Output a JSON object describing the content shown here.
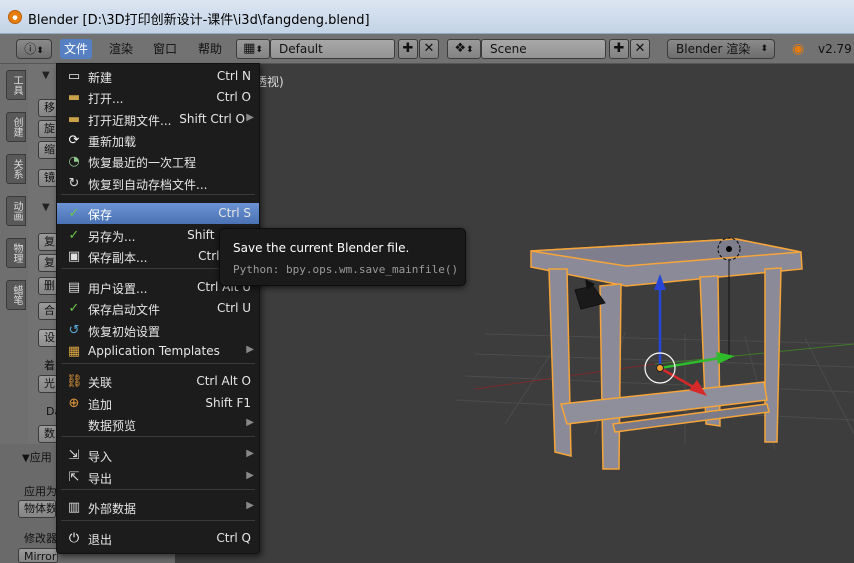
{
  "window": {
    "title": "Blender [D:\\3D打印创新设计-课件\\i3d\\fangdeng.blend]"
  },
  "header": {
    "menus": [
      "文件",
      "渲染",
      "窗口",
      "帮助"
    ],
    "screen_layout": "Default",
    "scene": "Scene",
    "render_engine": "Blender 渲染",
    "version": "v2.79"
  },
  "tool_tabs": [
    "工具",
    "创建",
    "关系",
    "动画",
    "物理",
    "蜡笔"
  ],
  "tool_panel": {
    "partial_labels": [
      "移",
      "旋",
      "缩",
      "镜",
      "复",
      "复",
      "删",
      "合",
      "设",
      "着",
      "光",
      "Da",
      "数",
      "应用",
      "应用为",
      "物体数",
      "修改器",
      "Mirror"
    ]
  },
  "viewport": {
    "label": "透视)",
    "obscured_label": "用"
  },
  "file_menu": {
    "items": [
      {
        "icon": "new-file-icon",
        "label": "新建",
        "shortcut": "Ctrl N"
      },
      {
        "icon": "open-folder-icon",
        "label": "打开...",
        "shortcut": "Ctrl O"
      },
      {
        "icon": "open-recent-icon",
        "label": "打开近期文件...",
        "shortcut": "Shift Ctrl O",
        "submenu": true
      },
      {
        "icon": "reload-icon",
        "label": "重新加载",
        "shortcut": ""
      },
      {
        "icon": "recover-last-icon",
        "label": "恢复最近的一次工程",
        "shortcut": ""
      },
      {
        "icon": "recover-auto-icon",
        "label": "恢复到自动存档文件...",
        "shortcut": ""
      },
      {
        "icon": "save-icon",
        "label": "保存",
        "shortcut": "Ctrl S",
        "selected": true
      },
      {
        "icon": "save-as-icon",
        "label": "另存为...",
        "shortcut": "Shift Ctrl S"
      },
      {
        "icon": "save-copy-icon",
        "label": "保存副本...",
        "shortcut": "Ctrl Alt S"
      },
      {
        "icon": "user-prefs-icon",
        "label": "用户设置...",
        "shortcut": "Ctrl Alt U"
      },
      {
        "icon": "save-startup-icon",
        "label": "保存启动文件",
        "shortcut": "Ctrl U"
      },
      {
        "icon": "factory-settings-icon",
        "label": "恢复初始设置",
        "shortcut": ""
      },
      {
        "icon": "templates-icon",
        "label": "Application Templates",
        "shortcut": "",
        "submenu": true
      },
      {
        "icon": "link-icon",
        "label": "关联",
        "shortcut": "Ctrl Alt O"
      },
      {
        "icon": "append-icon",
        "label": "追加",
        "shortcut": "Shift F1"
      },
      {
        "icon": "",
        "label": "数据预览",
        "shortcut": "",
        "submenu": true
      },
      {
        "icon": "import-icon",
        "label": "导入",
        "shortcut": "",
        "submenu": true
      },
      {
        "icon": "export-icon",
        "label": "导出",
        "shortcut": "",
        "submenu": true
      },
      {
        "icon": "external-data-icon",
        "label": "外部数据",
        "shortcut": "",
        "submenu": true
      },
      {
        "icon": "quit-icon",
        "label": "退出",
        "shortcut": "Ctrl Q"
      }
    ]
  },
  "tooltip": {
    "description": "Save the current Blender file.",
    "python": "Python: bpy.ops.wm.save_mainfile()"
  },
  "colors": {
    "selection": "#5680c2",
    "menu_bg": "#1c1c1c",
    "viewport_bg": "#3d3d3d",
    "object_outline": "#f5a53a"
  }
}
